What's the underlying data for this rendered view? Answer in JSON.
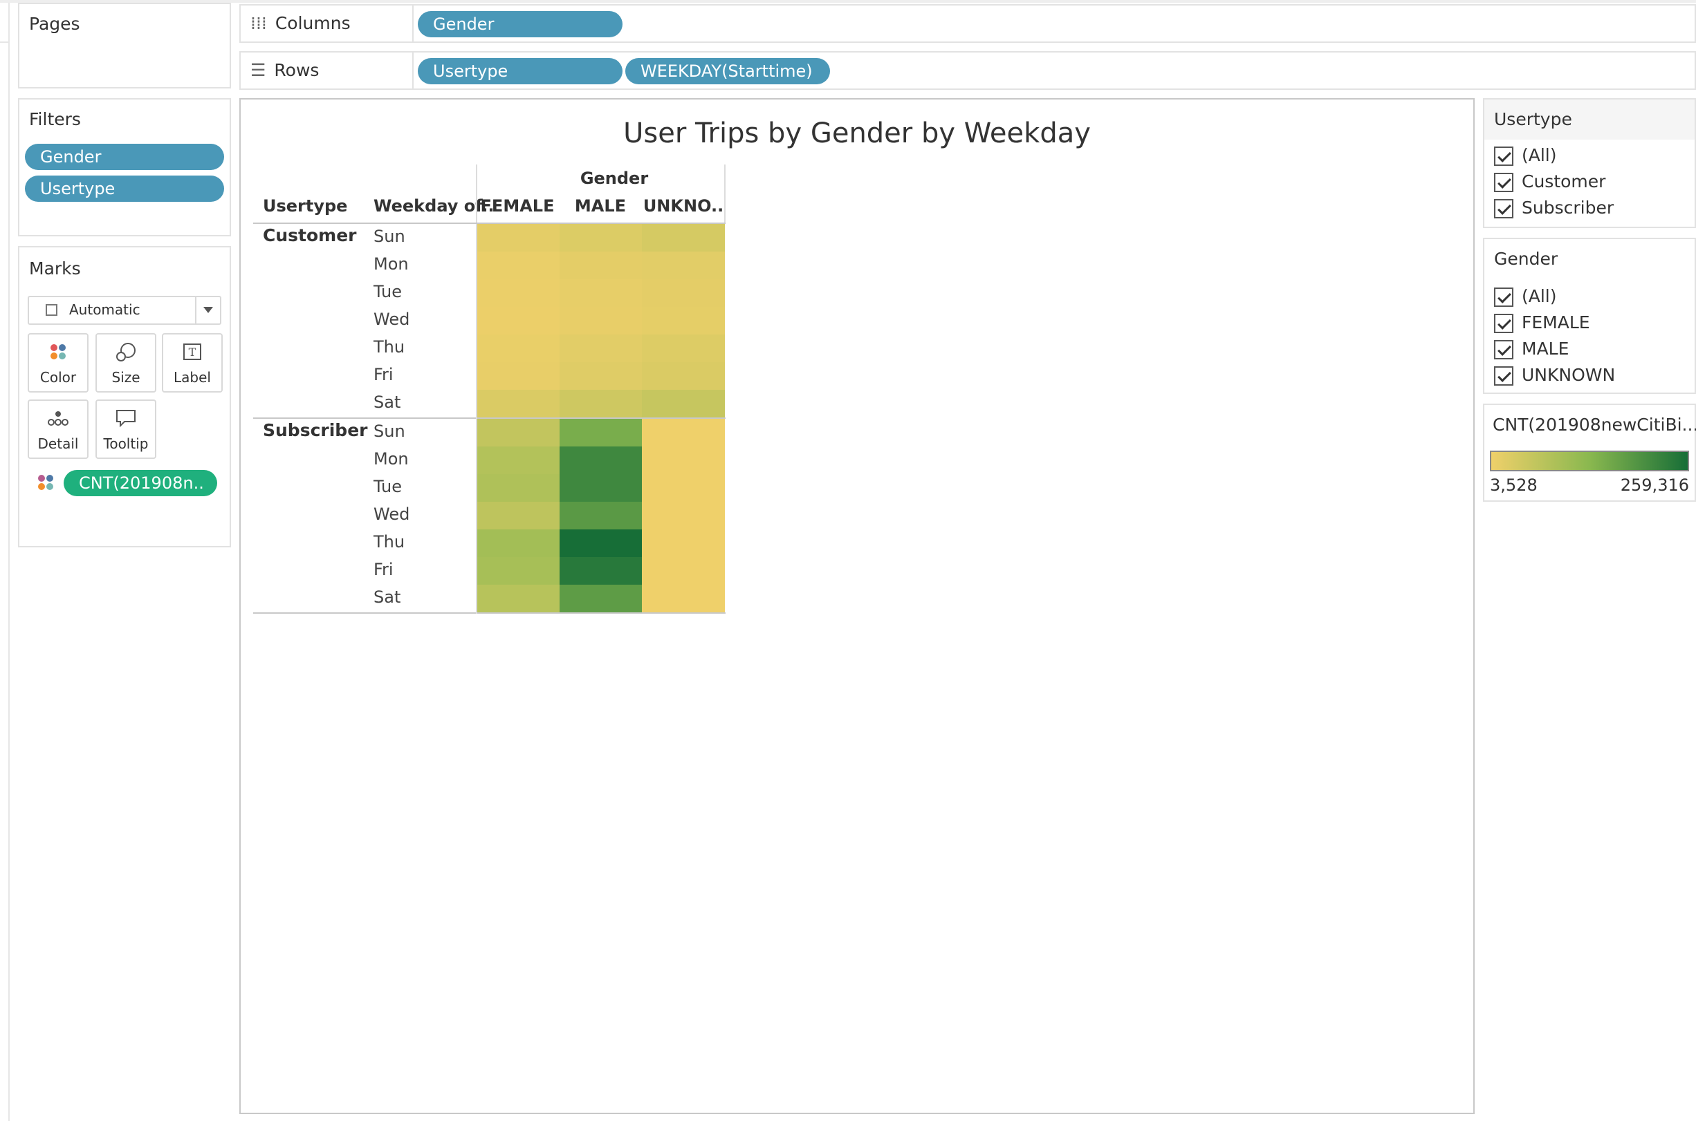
{
  "pages": {
    "title": "Pages"
  },
  "shelves": {
    "columns": {
      "label": "Columns",
      "pills": [
        "Gender"
      ]
    },
    "rows": {
      "label": "Rows",
      "pills": [
        "Usertype",
        "WEEKDAY(Starttime)"
      ]
    }
  },
  "filters": {
    "title": "Filters",
    "pills": [
      "Gender",
      "Usertype"
    ]
  },
  "marks": {
    "title": "Marks",
    "type_select": "Automatic",
    "buttons": [
      {
        "label": "Color",
        "icon": "color-dots-icon"
      },
      {
        "label": "Size",
        "icon": "size-circles-icon"
      },
      {
        "label": "Label",
        "icon": "label-t-icon"
      },
      {
        "label": "Detail",
        "icon": "detail-dots-icon"
      },
      {
        "label": "Tooltip",
        "icon": "tooltip-bubble-icon"
      }
    ],
    "field_pill": "CNT(201908n.."
  },
  "view": {
    "title": "User Trips by Gender by Weekday",
    "col_group_header": "Gender",
    "row_headers": [
      "Usertype",
      "Weekday of.."
    ],
    "col_headers": [
      "FEMALE",
      "MALE",
      "UNKNO.."
    ]
  },
  "chart_data": {
    "type": "heatmap",
    "title": "User Trips by Gender by Weekday",
    "columns": [
      "FEMALE",
      "MALE",
      "UNKNO.."
    ],
    "groups": [
      {
        "name": "Customer",
        "rows": [
          "Sun",
          "Mon",
          "Tue",
          "Wed",
          "Thu",
          "Fri",
          "Sat"
        ],
        "values": [
          [
            18000,
            27000,
            36000
          ],
          [
            10000,
            17000,
            20000
          ],
          [
            8000,
            14000,
            17000
          ],
          [
            7500,
            13000,
            16000
          ],
          [
            11000,
            20000,
            26000
          ],
          [
            13000,
            24000,
            30000
          ],
          [
            30000,
            45000,
            55000
          ]
        ]
      },
      {
        "name": "Subscriber",
        "rows": [
          "Sun",
          "Mon",
          "Tue",
          "Wed",
          "Thu",
          "Fri",
          "Sat"
        ],
        "values": [
          [
            60000,
            150000,
            3528
          ],
          [
            80000,
            215000,
            3528
          ],
          [
            85000,
            215000,
            3528
          ],
          [
            65000,
            185000,
            3528
          ],
          [
            100000,
            259316,
            3528
          ],
          [
            95000,
            240000,
            3528
          ],
          [
            75000,
            180000,
            3528
          ]
        ]
      }
    ],
    "color_range": [
      3528,
      259316
    ],
    "colors": {
      "low": "#efd06a",
      "mid": "#8ab84f",
      "high": "#176e37"
    }
  },
  "legend_usertype": {
    "title": "Usertype",
    "items": [
      "(All)",
      "Customer",
      "Subscriber"
    ]
  },
  "legend_gender": {
    "title": "Gender",
    "items": [
      "(All)",
      "FEMALE",
      "MALE",
      "UNKNOWN"
    ]
  },
  "color_legend": {
    "title": "CNT(201908newCitiBi...",
    "min_label": "3,528",
    "max_label": "259,316"
  }
}
